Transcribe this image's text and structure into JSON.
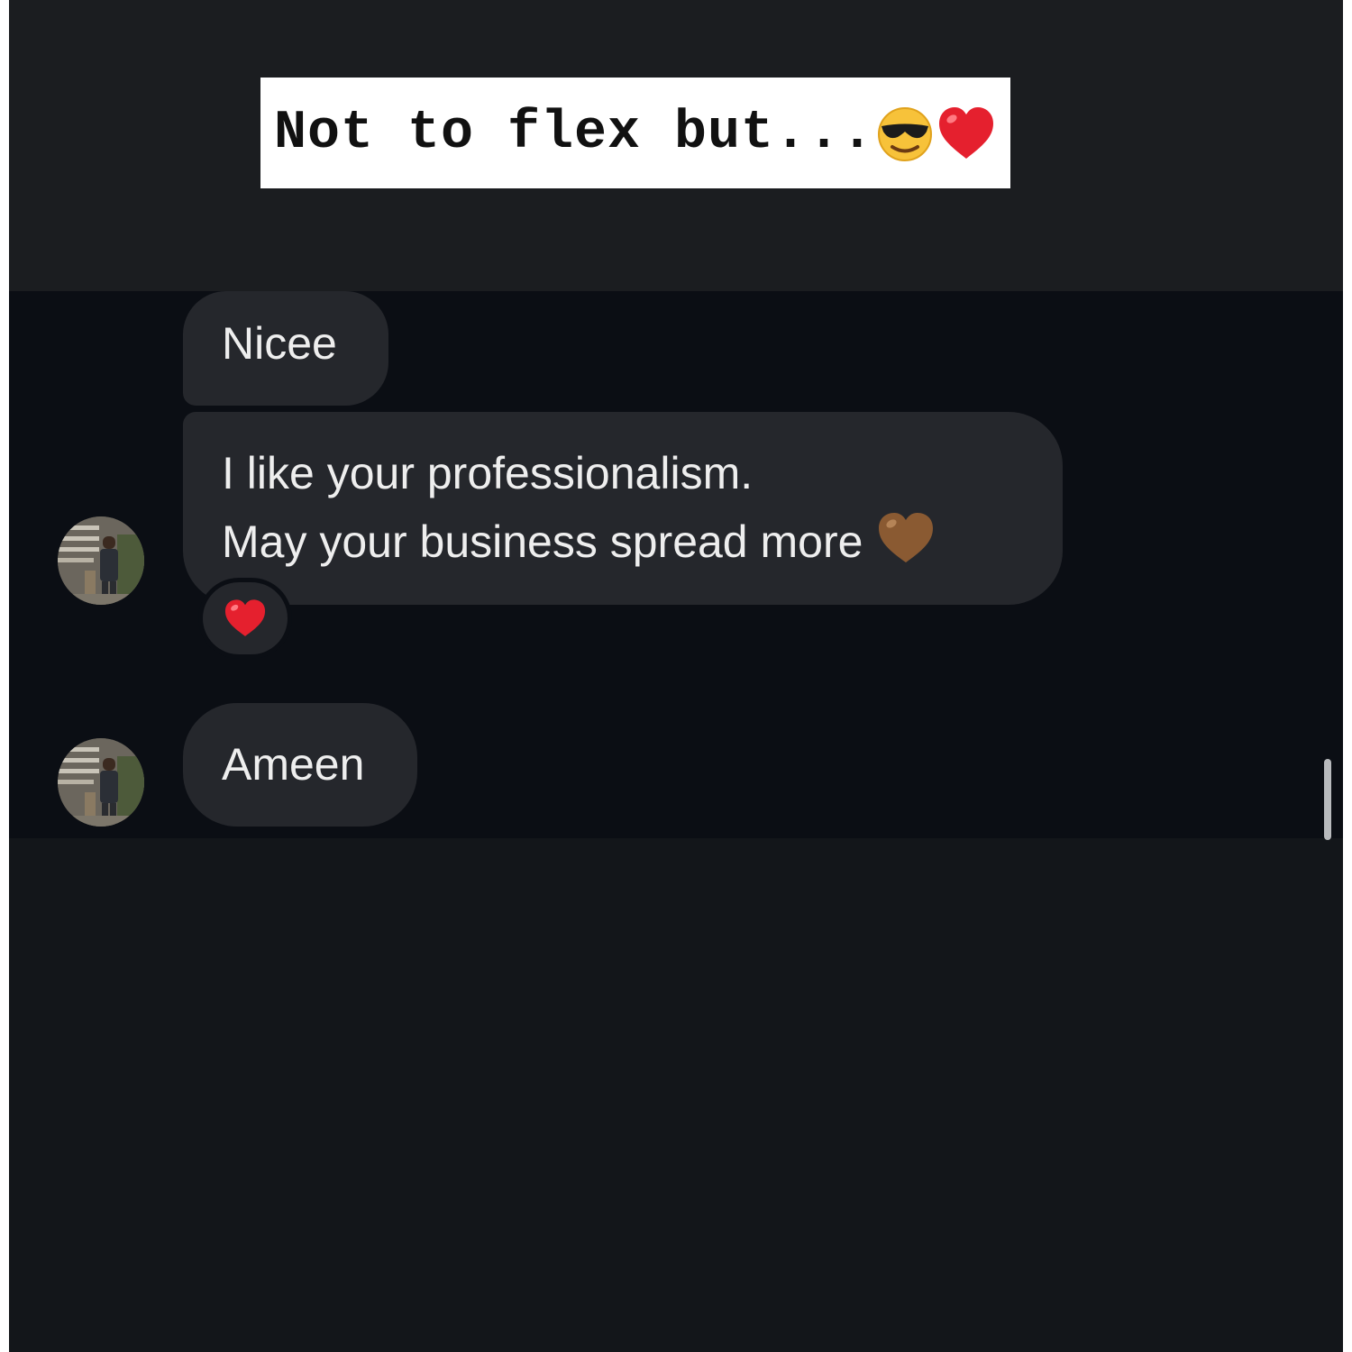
{
  "caption": {
    "text": "Not to flex but...",
    "emojis": [
      "smiling-face-with-sunglasses",
      "red-heart"
    ]
  },
  "messages": [
    {
      "text": "Nicee"
    },
    {
      "lines": [
        "I like your professionalism.",
        "May your business spread more"
      ],
      "emoji": "brown-heart",
      "reaction": "red-heart"
    },
    {
      "text": "Ameen"
    }
  ],
  "colors": {
    "top_band": "#1b1d20",
    "chat_background": "#0b0e14",
    "lower_background": "#13161a",
    "bubble": "#25272c",
    "bubble_text": "#eeeeee",
    "caption_background": "#ffffff"
  }
}
